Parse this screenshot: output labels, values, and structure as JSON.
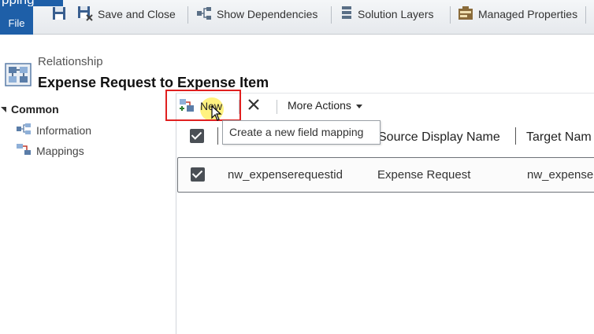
{
  "app": {
    "title_fragment": "pping"
  },
  "ribbon": {
    "file_tab": "File",
    "save_close": "Save and Close",
    "show_dependencies": "Show Dependencies",
    "solution_layers": "Solution Layers",
    "managed_properties": "Managed Properties"
  },
  "header": {
    "entity_type": "Relationship",
    "record_title": "Expense Request to Expense Item"
  },
  "nav": {
    "group": "Common",
    "items": [
      {
        "label": "Information"
      },
      {
        "label": "Mappings"
      }
    ]
  },
  "toolbar": {
    "new_label": "New",
    "more_actions": "More Actions",
    "tooltip": "Create a new field mapping"
  },
  "grid": {
    "columns": [
      "Source Display Name",
      "Target Nam"
    ],
    "rows": [
      {
        "source_name": "nw_expenserequestid",
        "source_display": "Expense Request",
        "target_name": "nw_expense"
      }
    ]
  },
  "icons": [
    "save-close-icon",
    "dependencies-icon",
    "solution-layers-icon",
    "managed-properties-icon",
    "relationship-icon",
    "collapse-triangle-icon",
    "information-icon",
    "mappings-icon",
    "new-mapping-icon",
    "delete-icon",
    "dropdown-caret-icon",
    "mouse-cursor-icon",
    "checkbox-icon"
  ],
  "colors": {
    "brand": "#1e5fa8",
    "highlight": "#e02020",
    "cursor_glow": "#ffeb3c"
  }
}
